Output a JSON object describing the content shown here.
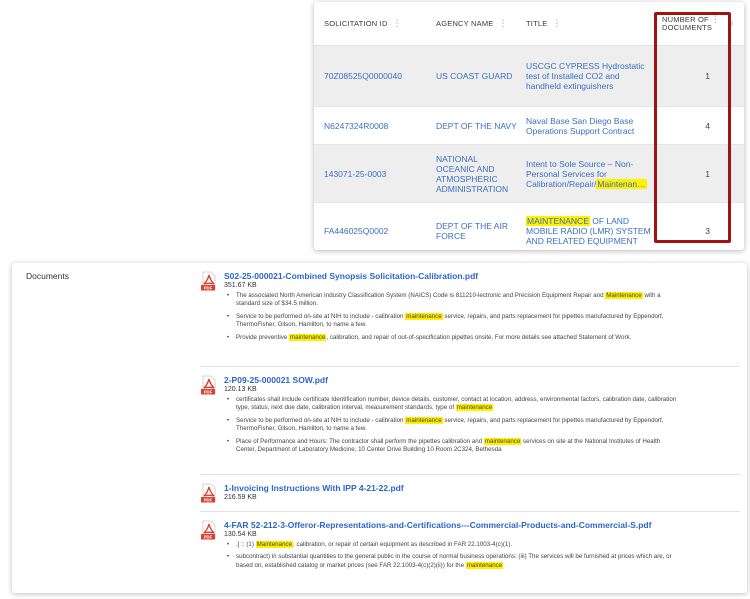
{
  "table": {
    "columns": [
      {
        "label": "SOLICITATION ID"
      },
      {
        "label": "AGENCY NAME"
      },
      {
        "label": "TITLE"
      },
      {
        "label_line1": "NUMBER OF",
        "label_line2": "DOCUMENTS"
      }
    ],
    "extra_col_label": "D",
    "rows": [
      {
        "id": "70Z08525Q0000040",
        "agency": "US COAST GUARD",
        "title": "USCGC CYPRESS Hydrostatic test of Installed CO2 and handheld extinguishers",
        "docs": "1"
      },
      {
        "id": "N6247324R0008",
        "agency": "DEPT OF THE NAVY",
        "title": "Naval Base San Diego Base Operations Support Contract",
        "docs": "4"
      },
      {
        "id": "143071-25-0003",
        "agency": "NATIONAL OCEANIC AND ATMOSPHERIC ADMINISTRATION",
        "title_pre": "Intent to Sole Source – Non-Personal Services for Calibration/Repair/",
        "title_mark": "Maintenan…",
        "docs": "1"
      },
      {
        "id": "FA446025Q0002",
        "agency": "DEPT OF THE AIR FORCE",
        "title_mark": "MAINTENANCE",
        "title_post": " OF LAND MOBILE RADIO (LMR) SYSTEM AND RELATED EQUIPMENT",
        "docs": "3"
      }
    ]
  },
  "documents": {
    "label": "Documents",
    "items": [
      {
        "name": "S02-25-000021-Combined Synopsis Solicitation-Calibration.pdf",
        "size": "351.67 KB",
        "snippets": [
          {
            "l1a": "The associated North American Industry Classification System (NAICS) Code is 811210-lectronic and Precision Equipment Repair and ",
            "l1m": "Maintenance",
            "l1b": " with a",
            "l2a": "standard size of $34.5 million."
          },
          {
            "l1a": "Service to be performed on-site at NIH to include - calibration ",
            "l1m": "maintenance",
            "l1b": " service, repairs, and parts replacement for pipettes manufactured by Eppendorf,",
            "l2a": "ThermoFisher, Gilson, Hamilton, to name a few."
          },
          {
            "l1a": "Provide preventive ",
            "l1m": "maintenance",
            "l1b": ", calibration, and repair of out-of-specification pipettes onsite. For more details see attached Statement of Work."
          }
        ]
      },
      {
        "name": "2-P09-25-000021 SOW.pdf",
        "size": "120.13 KB",
        "snippets": [
          {
            "l1a": "certificates shall include certificate Identification number, device details, customer, contact at location, address, environmental factors, calibration date, calibration",
            "l2a": "type, status, next due date, calibration interval, measurement standards, type of ",
            "l2m": "maintenance"
          },
          {
            "l1a": "Service to be performed on-site at NIH to include - calibration ",
            "l1m": "maintenance",
            "l1b": " service, repairs, and parts replacement for pipettes manufactured by Eppendorf,",
            "l2a": "ThermoFisher, Gilson, Hamilton, to name a few."
          },
          {
            "l1a": "Place of Performance and Hours: The contractor shall perform the pipettes calibration and ",
            "l1m": "maintenance",
            "l1b": " services on site at the National Institutes of Health",
            "l2a": "Center, Department of Laboratory Medicine, 10 Center Drive Building 10 Room 2C324, Bethesda"
          }
        ]
      },
      {
        "name": "1-Invoicing Instructions With IPP 4-21-22.pdf",
        "size": "216.59 KB",
        "snippets": []
      },
      {
        "name": "4-FAR 52-212-3-Offeror-Representations-and-Certifications---Commercial-Products-and-Commercial-S.pdf",
        "size": "130.54 KB",
        "snippets": [
          {
            "l1a": ".] :: (1) ",
            "l1m": "Maintenance",
            "l1b": ", calibration, or repair of certain equipment as described in FAR 22.1003-4(c)(1)."
          },
          {
            "l1a": "subcontract) in substantial quantities to the general public in the course of normal business operations: (iii) The services will be furnished at prices which are, or",
            "l2a": "based on, established catalog or market prices (see FAR 22.1003-4(c)(2)(ii)) for the ",
            "l2m": "maintenance"
          }
        ]
      }
    ]
  },
  "colors": {
    "link": "#2d65c9",
    "highlight": "#ffef00",
    "callout_border": "#a31212",
    "row_shade": "#eeeeee"
  },
  "icons": {
    "column_menu": "kebab-icon",
    "document": "pdf-file-icon"
  }
}
